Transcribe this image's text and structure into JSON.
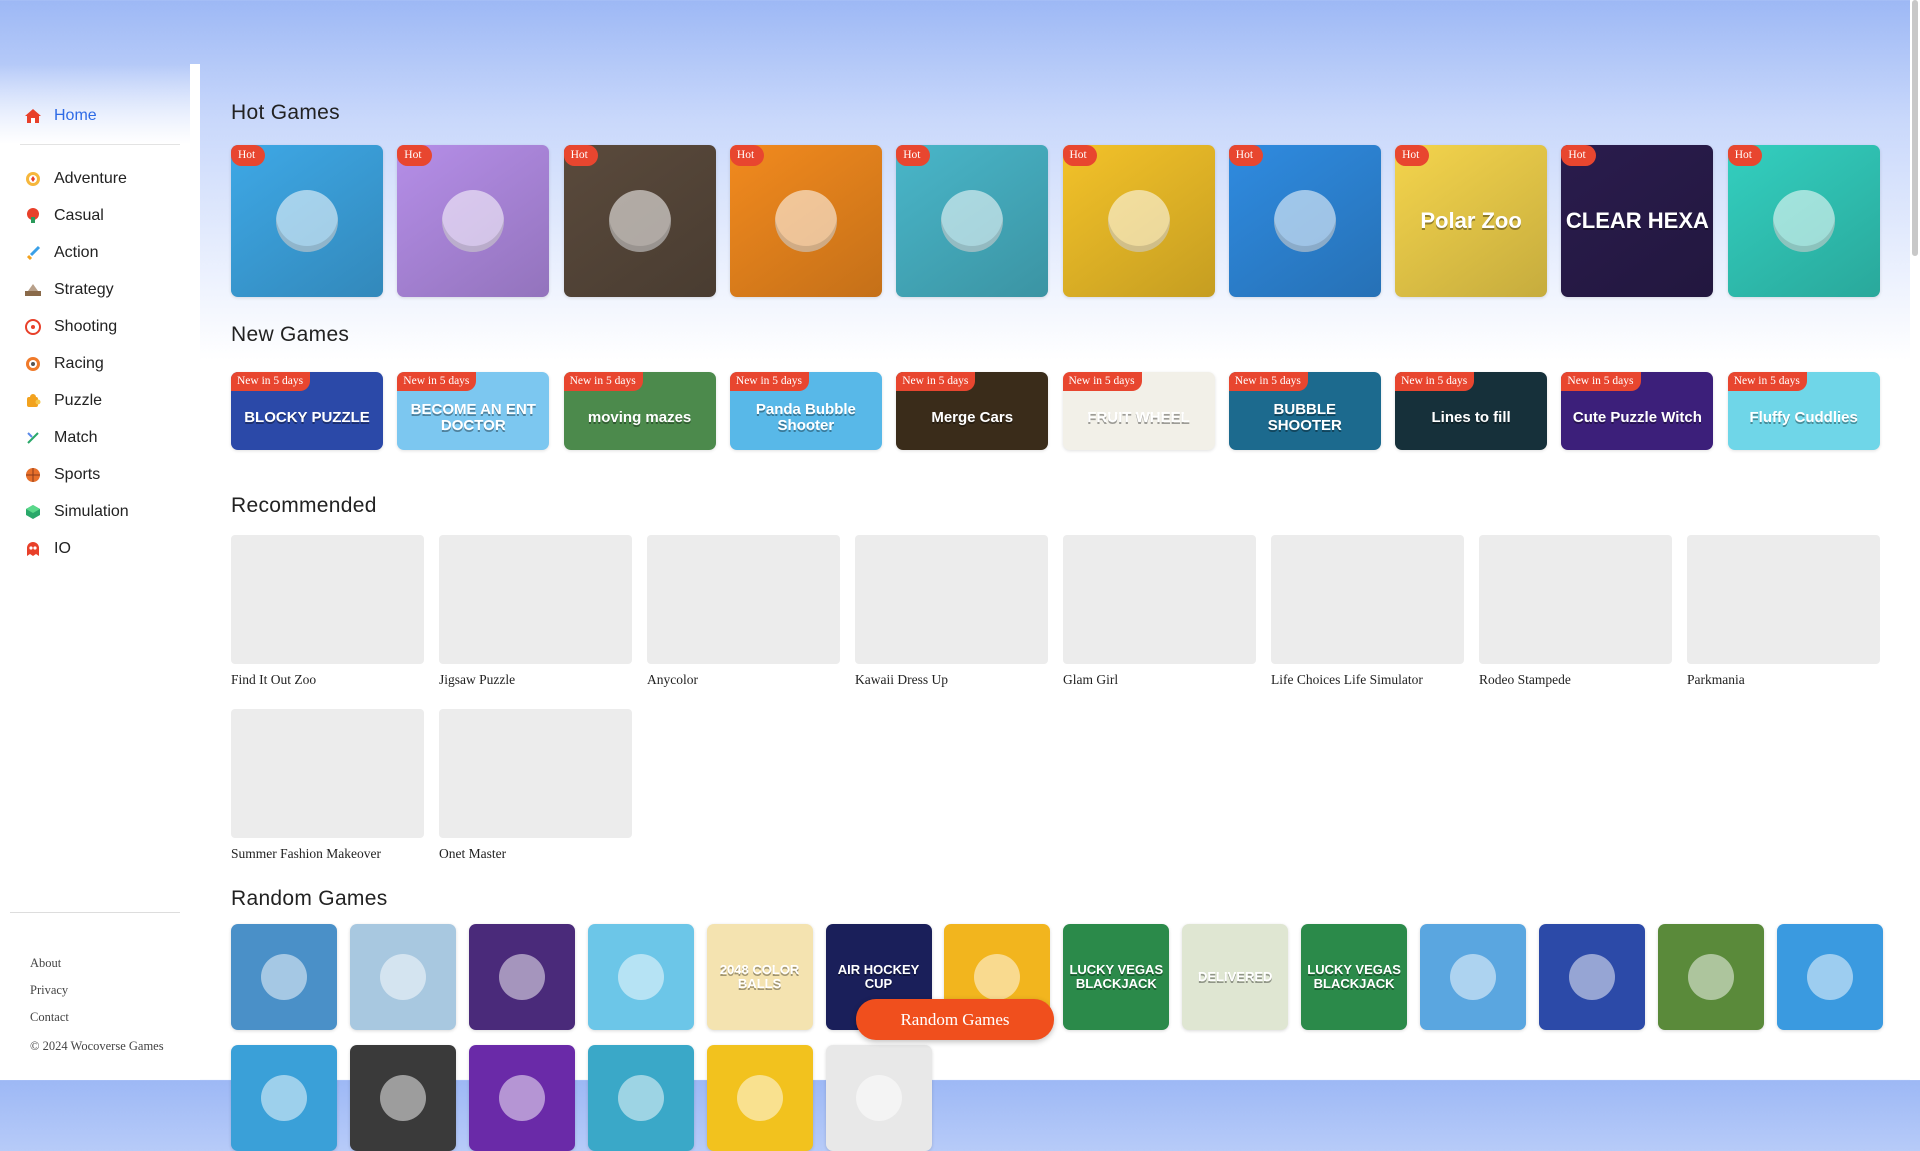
{
  "sidebar": {
    "home": {
      "label": "Home",
      "icon": "home-icon",
      "color": "#2e6be6"
    },
    "items": [
      {
        "label": "Adventure",
        "icon": "compass-icon"
      },
      {
        "label": "Casual",
        "icon": "mushroom-icon"
      },
      {
        "label": "Action",
        "icon": "sword-icon"
      },
      {
        "label": "Strategy",
        "icon": "chess-icon"
      },
      {
        "label": "Shooting",
        "icon": "target-icon"
      },
      {
        "label": "Racing",
        "icon": "wheel-icon"
      },
      {
        "label": "Puzzle",
        "icon": "puzzle-icon"
      },
      {
        "label": "Match",
        "icon": "match-icon"
      },
      {
        "label": "Sports",
        "icon": "ball-icon"
      },
      {
        "label": "Simulation",
        "icon": "globe-icon"
      },
      {
        "label": "IO",
        "icon": "ghost-icon"
      }
    ],
    "footer": {
      "about": "About",
      "privacy": "Privacy",
      "contact": "Contact",
      "copyright": "© 2024 Wocoverse Games"
    }
  },
  "hot_games": {
    "title": "Hot Games",
    "badge": "Hot",
    "tiles": [
      {
        "icon": "fish-icon",
        "bg": "#3ea8e6",
        "text": ""
      },
      {
        "icon": "chocolate-icon",
        "bg": "#b58ee8",
        "text": ""
      },
      {
        "icon": "ape-icon",
        "bg": "#5a4a3c",
        "text": ""
      },
      {
        "icon": "burger-icon",
        "bg": "#f28a1e",
        "text": ""
      },
      {
        "icon": "soccer-ball-icon",
        "bg": "#49b6c9",
        "text": ""
      },
      {
        "icon": "boxer-icon",
        "bg": "#f3c229",
        "text": ""
      },
      {
        "icon": "fruit-basket-icon",
        "bg": "#2f8be0",
        "text": ""
      },
      {
        "icon": "penguin-icon",
        "bg": "#f4d44c",
        "text": "Polar Zoo"
      },
      {
        "icon": "hexagon-icon",
        "bg": "#2a1c4d",
        "text": "CLEAR HEXA"
      },
      {
        "icon": "maze-cube-icon",
        "bg": "#33cfbf",
        "text": ""
      }
    ]
  },
  "new_games": {
    "title": "New Games",
    "badge": "New in 5 days",
    "tiles": [
      {
        "icon": "blocks-icon",
        "bg": "#2b49a8",
        "text": "BLOCKY PUZZLE"
      },
      {
        "icon": "doctor-icon",
        "bg": "#7cc7f0",
        "text": "BECOME AN ENT DOCTOR"
      },
      {
        "icon": "maze-icon",
        "bg": "#4c8a4c",
        "text": "moving mazes"
      },
      {
        "icon": "bubbles-icon",
        "bg": "#58b8e8",
        "text": "Panda Bubble Shooter"
      },
      {
        "icon": "car-icon",
        "bg": "#3a2c1a",
        "text": "Merge Cars"
      },
      {
        "icon": "wheel-fruit-icon",
        "bg": "#f2f0e8",
        "text": "FRUIT WHEEL"
      },
      {
        "icon": "bubble-icon",
        "bg": "#1c6a8e",
        "text": "BUBBLE SHOOTER"
      },
      {
        "icon": "lines-icon",
        "bg": "#16303a",
        "text": "Lines to fill"
      },
      {
        "icon": "witch-icon",
        "bg": "#3c1f7a",
        "text": "Cute Puzzle Witch"
      },
      {
        "icon": "pig-icon",
        "bg": "#6fd6e8",
        "text": "Fluffy Cuddlies"
      }
    ]
  },
  "recommended": {
    "title": "Recommended",
    "items": [
      "Find It Out Zoo",
      "Jigsaw Puzzle",
      "Anycolor",
      "Kawaii Dress Up",
      "Glam Girl",
      "Life Choices Life Simulator",
      "Rodeo Stampede",
      "Parkmania",
      "Summer Fashion Makeover",
      "Onet Master"
    ]
  },
  "random_games": {
    "title": "Random Games",
    "button": "Random Games",
    "row1": [
      {
        "icon": "tennis-icon",
        "bg": "#4a90c8",
        "text": ""
      },
      {
        "icon": "snowman-icon",
        "bg": "#a8c8e0",
        "text": ""
      },
      {
        "icon": "dartboard-icon",
        "bg": "#4a2a7a",
        "text": ""
      },
      {
        "icon": "soccer-player-icon",
        "bg": "#6cc6e8",
        "text": ""
      },
      {
        "icon": "2048-icon",
        "bg": "#f4e3b0",
        "text": "2048 COLOR BALLS"
      },
      {
        "icon": "air-hockey-icon",
        "bg": "#1a1f5a",
        "text": "AIR HOCKEY CUP"
      },
      {
        "icon": "mug-icon",
        "bg": "#f2b51e",
        "text": ""
      },
      {
        "icon": "cards-icon",
        "bg": "#2b8a4a",
        "text": "LUCKY VEGAS BLACKJACK"
      },
      {
        "icon": "delivery-icon",
        "bg": "#dfe6d2",
        "text": "DELIVERED"
      },
      {
        "icon": "cards-icon",
        "bg": "#2b8a4a",
        "text": "LUCKY VEGAS BLACKJACK"
      },
      {
        "icon": "chicken-icon",
        "bg": "#5aa6e0",
        "text": ""
      },
      {
        "icon": "crab-icon",
        "bg": "#2c4aa8",
        "text": ""
      },
      {
        "icon": "checker-icon",
        "bg": "#5a8a3a",
        "text": ""
      },
      {
        "icon": "runner-icon",
        "bg": "#3a9ae0",
        "text": ""
      }
    ],
    "row2": [
      {
        "icon": "viking-icon",
        "bg": "#3aa0d8",
        "text": ""
      },
      {
        "icon": "deer-icon",
        "bg": "#3a3a3a",
        "text": ""
      },
      {
        "icon": "block-icon",
        "bg": "#6a2aa8",
        "text": ""
      },
      {
        "icon": "hero-icon",
        "bg": "#3aa8c8",
        "text": ""
      },
      {
        "icon": "money-icon",
        "bg": "#f2c21e",
        "text": ""
      },
      {
        "icon": "parking-icon",
        "bg": "#e8e8e8",
        "text": ""
      }
    ]
  }
}
